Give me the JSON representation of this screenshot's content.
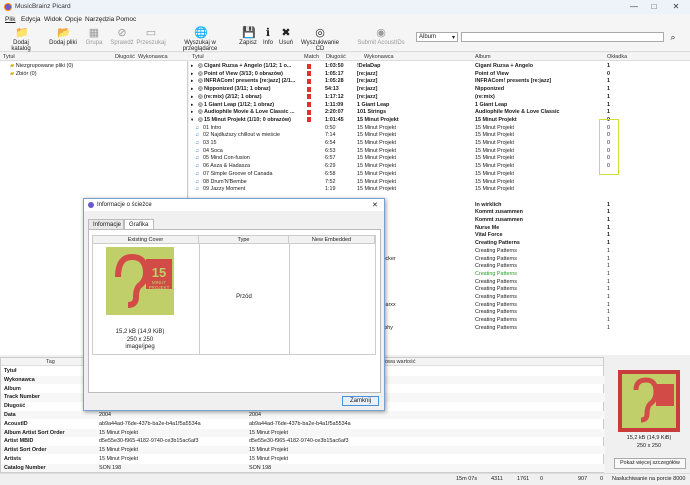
{
  "window": {
    "title": "MusicBrainz Picard",
    "min": "—",
    "max": "□",
    "close": "✕"
  },
  "menu": [
    "Plik",
    "Edycja",
    "Widok",
    "Opcje",
    "Narzędzia",
    "Pomoc"
  ],
  "toolbar": [
    {
      "label": "Dodaj katalog",
      "icon": "folder-icon",
      "glyph": "📁",
      "enabled": true
    },
    {
      "label": "Dodaj pliki",
      "icon": "file-add-icon",
      "glyph": "📂",
      "enabled": true
    },
    {
      "label": "Grupa",
      "icon": "cluster-icon",
      "glyph": "▦",
      "enabled": false
    },
    {
      "label": "Sprawdź",
      "icon": "lookup-icon",
      "glyph": "⊘",
      "enabled": false
    },
    {
      "label": "Przeszukaj",
      "icon": "scan-icon",
      "glyph": "▭",
      "enabled": false
    },
    {
      "label": "Wyszukaj w przeglądarce",
      "icon": "globe-icon",
      "glyph": "🌐",
      "enabled": true
    },
    {
      "label": "Zapisz",
      "icon": "save-icon",
      "glyph": "💾",
      "enabled": true
    },
    {
      "label": "Info",
      "icon": "info-icon",
      "glyph": "ℹ",
      "enabled": true
    },
    {
      "label": "Usuń",
      "icon": "remove-icon",
      "glyph": "✖",
      "enabled": true
    },
    {
      "label": "Wyszukiwanie CD",
      "icon": "cd-icon",
      "glyph": "◎",
      "enabled": true
    },
    {
      "label": "Submit AcoustIDs",
      "icon": "fingerprint-icon",
      "glyph": "◉",
      "enabled": false
    }
  ],
  "search": {
    "type": "Album",
    "placeholder": ""
  },
  "left": {
    "headers": [
      "Tytuł",
      "Długość",
      "Wykonawca"
    ],
    "items": [
      "Niezgrupowane pliki (0)",
      "Zbiór (0)"
    ]
  },
  "right": {
    "headers": [
      "Tytuł",
      "Match",
      "Długość",
      "Wykonawca",
      "Album",
      "Okładka"
    ],
    "rows": [
      {
        "t": "Cigani Ruzsa + Angelo (1/12; 1 o...",
        "len": "1:03:50",
        "art": "!DelaDap",
        "alb": "Cigani Ruzsa + Angelo",
        "cov": "1",
        "bold": true
      },
      {
        "t": "Point of View (3/13; 0 obrazów)",
        "len": "1:05:17",
        "art": "[re:jazz]",
        "alb": "Point of View",
        "cov": "0",
        "bold": true
      },
      {
        "t": "INFRACom! presents [re:jazz] (2/1...",
        "len": "1:05:28",
        "art": "[re:jazz]",
        "alb": "INFRACom! presents [re:jazz]",
        "cov": "1",
        "bold": true
      },
      {
        "t": "Nipponized (3/11; 1 obraz)",
        "len": "54:13",
        "art": "[re:jazz]",
        "alb": "Nipponized",
        "cov": "1",
        "bold": true
      },
      {
        "t": "(re:mix) (2/12; 1 obraz)",
        "len": "1:17:12",
        "art": "[re:jazz]",
        "alb": "(re:mix)",
        "cov": "1",
        "bold": true
      },
      {
        "t": "1 Giant Leap (1/12; 1 obraz)",
        "len": "1:11:09",
        "art": "1 Giant Leap",
        "alb": "1 Giant Leap",
        "cov": "1",
        "bold": true
      },
      {
        "t": "Audiophile Movie & Love Classic ...",
        "len": "2:20:07",
        "art": "101 Strings",
        "alb": "Audiophile Movie & Love Classic",
        "cov": "1",
        "bold": true
      },
      {
        "t": "15 Minut Projekt (1/10; 0 obrazów)",
        "len": "1:01:45",
        "art": "15 Minut Projekt",
        "alb": "15 Minut Projekt",
        "cov": "0",
        "bold": true,
        "open": true
      },
      {
        "t": "01  Intro",
        "len": "0:50",
        "art": "15 Minut Projekt",
        "alb": "15 Minut Projekt",
        "cov": "0"
      },
      {
        "t": "02  Najdłuższy chillout w mieście",
        "len": "7:14",
        "art": "15 Minut Projekt",
        "alb": "15 Minut Projekt",
        "cov": "0"
      },
      {
        "t": "03  15",
        "len": "6:54",
        "art": "15 Minut Projekt",
        "alb": "15 Minut Projekt",
        "cov": "0"
      },
      {
        "t": "04  Soca",
        "len": "6:53",
        "art": "15 Minut Projekt",
        "alb": "15 Minut Projekt",
        "cov": "0"
      },
      {
        "t": "05  Mind Con-fusion",
        "len": "6:57",
        "art": "15 Minut Projekt",
        "alb": "15 Minut Projekt",
        "cov": "0"
      },
      {
        "t": "06  Asza & Hadasza",
        "len": "6:29",
        "art": "15 Minut Projekt",
        "alb": "15 Minut Projekt",
        "cov": "0"
      },
      {
        "t": "07  Simple Groove of Canada",
        "len": "6:58",
        "art": "15 Minut Projekt",
        "alb": "15 Minut Projekt",
        "cov": ""
      },
      {
        "t": "08  Drum'N'Bembe",
        "len": "7:52",
        "art": "15 Minut Projekt",
        "alb": "15 Minut Projekt",
        "cov": ""
      },
      {
        "t": "09  Jazzy Moment",
        "len": "1:19",
        "art": "15 Minut Projekt",
        "alb": "15 Minut Projekt",
        "cov": ""
      },
      {
        "t": "",
        "len": "",
        "art": "",
        "alb": "",
        "cov": ""
      },
      {
        "t": "",
        "len": "",
        "art": "hohnung",
        "alb": "In wirklich",
        "cov": "1",
        "bold": true
      },
      {
        "t": "",
        "len": "",
        "art": "hohnung",
        "alb": "Kommt zusammen",
        "cov": "1",
        "bold": true
      },
      {
        "t": "",
        "len": "",
        "art": "hohnung",
        "alb": "Kommt zusammen",
        "cov": "1",
        "bold": true
      },
      {
        "t": "",
        "len": "",
        "art": "rter",
        "alb": "Nurse Me",
        "cov": "1",
        "bold": true
      },
      {
        "t": "",
        "len": "",
        "art": "",
        "alb": "Vital Force",
        "cov": "1",
        "bold": true
      },
      {
        "t": "",
        "len": "",
        "art": "",
        "alb": "Creating Patterns",
        "cov": "1",
        "bold": true
      },
      {
        "t": "",
        "len": "",
        "art": "",
        "alb": "Creating Patterns",
        "cov": "1"
      },
      {
        "t": "",
        "len": "",
        "art": "t. Ursula Rucker",
        "alb": "Creating Patterns",
        "cov": "1"
      },
      {
        "t": "",
        "len": "",
        "art": "",
        "alb": "Creating Patterns",
        "cov": "1"
      },
      {
        "t": "",
        "len": "",
        "art": "",
        "alb": "Creating Patterns",
        "cov": "1",
        "green": true
      },
      {
        "t": "",
        "len": "",
        "art": "t. Jill Scott",
        "alb": "Creating Patterns",
        "cov": "1"
      },
      {
        "t": "",
        "len": "",
        "art": "",
        "alb": "Creating Patterns",
        "cov": "1"
      },
      {
        "t": "",
        "len": "",
        "art": "",
        "alb": "Creating Patterns",
        "cov": "1"
      },
      {
        "t": "",
        "len": "",
        "art": "t. Patricia Marxx",
        "alb": "Creating Patterns",
        "cov": "1"
      },
      {
        "t": "",
        "len": "",
        "art": "",
        "alb": "Creating Patterns",
        "cov": "1"
      },
      {
        "t": "",
        "len": "",
        "art": "",
        "alb": "Creating Patterns",
        "cov": "1"
      },
      {
        "t": "",
        "len": "",
        "art": "t. Mark Murphy",
        "alb": "Creating Patterns",
        "cov": "1"
      }
    ]
  },
  "tags": {
    "headers": [
      "Tag",
      "",
      "Nowa wartość"
    ],
    "rows": [
      {
        "k": "Tytuł",
        "o": "",
        "n": ""
      },
      {
        "k": "Wykonawca",
        "o": "",
        "n": ""
      },
      {
        "k": "Album",
        "o": "",
        "n": ""
      },
      {
        "k": "Track Number",
        "o": "",
        "n": ""
      },
      {
        "k": "Długość",
        "o": "",
        "n": ""
      },
      {
        "k": "Data",
        "o": "2004",
        "n": "2004"
      },
      {
        "k": "AcoustID",
        "o": "ab9a44ad-76de-437b-ba2e-b4a1f5a5534a",
        "n": "ab9a44ad-76de-437b-ba2e-b4a1f5a5534a"
      },
      {
        "k": "Album Artist Sort Order",
        "o": "15 Minut Projekt",
        "n": "15 Minut Projekt"
      },
      {
        "k": "Artist MBID",
        "o": "d5e55e30-f965-4182-9740-ce3b15ac6af3",
        "n": "d5e55e30-f965-4182-9740-ce3b15ac6af3"
      },
      {
        "k": "Artist Sort Order",
        "o": "15 Minut Projekt",
        "n": "15 Minut Projekt"
      },
      {
        "k": "Artists",
        "o": "15 Minut Projekt",
        "n": "15 Minut Projekt"
      },
      {
        "k": "Catalog Number",
        "o": "SON 198",
        "n": "SON 198"
      }
    ]
  },
  "cover_preview": {
    "size": "15,2 kB (14,9 KiB)",
    "dims": "250 x 250",
    "button": "Pokaż więcej szczegółów"
  },
  "status": {
    "time": "15m 07s",
    "files": "4311",
    "a": "1761",
    "b": "0",
    "c": "907",
    "d": "0",
    "listen": "Nasłuchiwanie na porcie 8000"
  },
  "dialog": {
    "title": "Informacje o ścieżce",
    "tabs": [
      "Informacje",
      "Grafika"
    ],
    "cols": [
      "Existing Cover",
      "Type",
      "New Embedded"
    ],
    "cover_text": [
      "15",
      "MINUT",
      "PROJEKT"
    ],
    "size": "15,2 kB (14,9 KiB)",
    "dims": "250 x 250",
    "mime": "image/jpeg",
    "type": "Przód",
    "close": "Zamknij"
  }
}
